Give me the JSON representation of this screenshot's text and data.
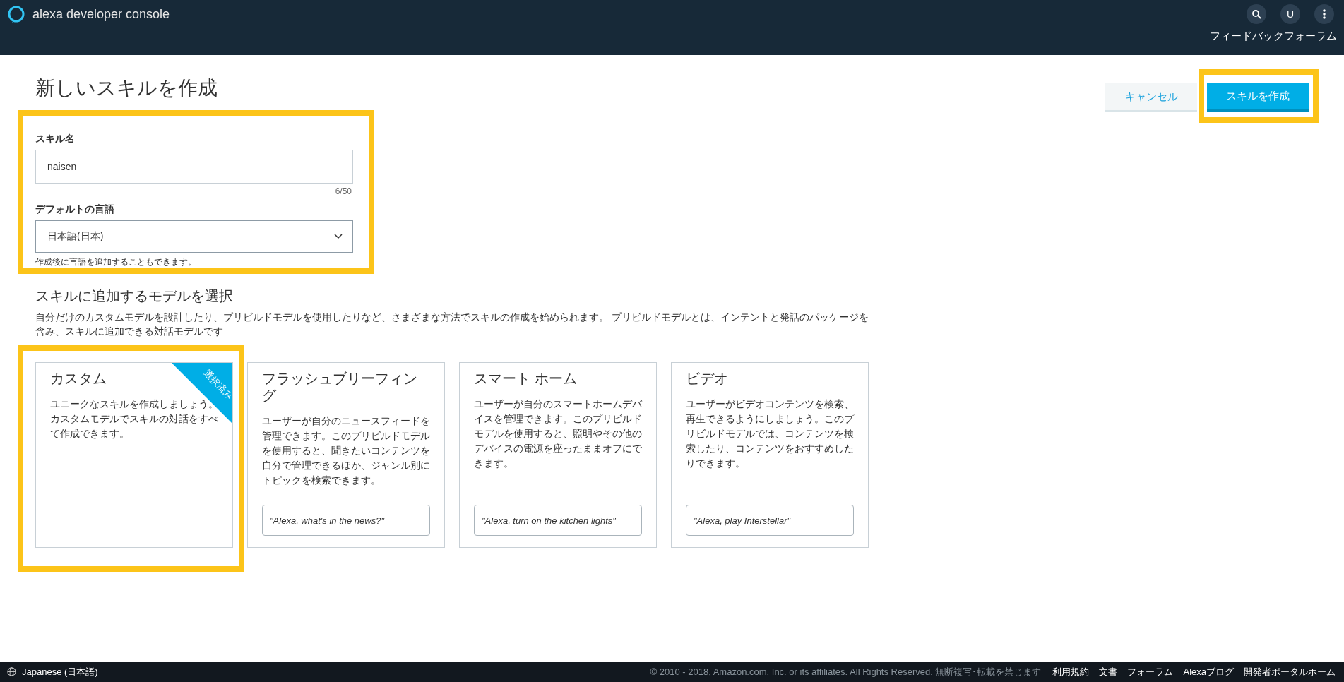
{
  "header": {
    "product": "alexa developer console",
    "avatar": "U",
    "feedback_link": "フィードバックフォーラム"
  },
  "page": {
    "title": "新しいスキルを作成",
    "cancel_button": "キャンセル",
    "create_button": {
      "label": "スキルを作成",
      "highlighted": true
    }
  },
  "form": {
    "highlighted": true,
    "skill_name": {
      "label": "スキル名",
      "value": "naisen",
      "counter": "6/50"
    },
    "language": {
      "label": "デフォルトの言語",
      "value": "日本語(日本)",
      "hint": "作成後に言語を追加することもできます。"
    }
  },
  "models": {
    "heading": "スキルに追加するモデルを選択",
    "description": "自分だけのカスタムモデルを設計したり、プリビルドモデルを使用したりなど、さまざまな方法でスキルの作成を始められます。 プリビルドモデルとは、インテントと発話のパッケージを含み、スキルに追加できる対話モデルです",
    "cards": [
      {
        "title": "カスタム",
        "text": "ユニークなスキルを作成しましょう。カスタムモデルでスキルの対話をすべて作成できます。",
        "selected": true,
        "badge": "選択済み",
        "highlighted": true
      },
      {
        "title": "フラッシュブリーフィング",
        "text": "ユーザーが自分のニュースフィードを管理できます。このプリビルドモデルを使用すると、聞きたいコンテンツを自分で管理できるほか、ジャンル別にトピックを検索できます。",
        "selected": false,
        "example": "\"Alexa, what's in the news?\"",
        "highlighted": false
      },
      {
        "title": "スマート ホーム",
        "text": "ユーザーが自分のスマートホームデバイスを管理できます。このプリビルドモデルを使用すると、照明やその他のデバイスの電源を座ったままオフにできます。",
        "selected": false,
        "example": "\"Alexa, turn on the kitchen lights\"",
        "highlighted": false
      },
      {
        "title": "ビデオ",
        "text": "ユーザーがビデオコンテンツを検索、再生できるようにしましょう。このプリビルドモデルでは、コンテンツを検索したり、コンテンツをおすすめしたりできます。",
        "selected": false,
        "example": "\"Alexa, play Interstellar\"",
        "highlighted": false
      }
    ]
  },
  "footer": {
    "language": "Japanese (日本語)",
    "copyright": "© 2010 - 2018, Amazon.com, Inc. or its affiliates. All Rights Reserved. 無断複写･転載を禁じます",
    "links": [
      "利用規約",
      "文書",
      "フォーラム",
      "Alexaブログ",
      "開発者ポータルホーム"
    ]
  }
}
